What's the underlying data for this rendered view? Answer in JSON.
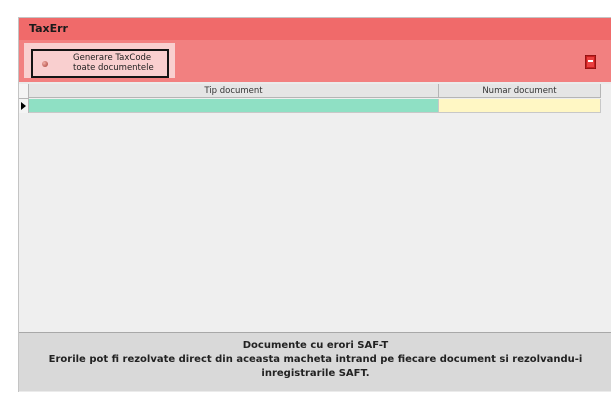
{
  "window": {
    "title": "TaxErr"
  },
  "toolbar": {
    "generate_button": {
      "line1": "Generare TaxCode",
      "line2": "toate documentele",
      "icon": "record-icon"
    },
    "exit_icon": "exit-door-icon"
  },
  "grid": {
    "columns": [
      {
        "label": "Tip document"
      },
      {
        "label": "Numar document"
      }
    ],
    "rows": [
      {
        "tip_document": "",
        "numar_document": ""
      }
    ]
  },
  "footer": {
    "title": "Documente cu erori SAF-T",
    "description": "Erorile pot fi rezolvate direct din aceasta macheta intrand pe fiecare document si rezolvandu-i inregistrarile SAFT."
  },
  "colors": {
    "titlebar": "#f06a6a",
    "toolbar": "#f28080",
    "tip_cell": "#8fe0c4",
    "numar_cell": "#fff7c4",
    "footer_bg": "#d9d9d9"
  }
}
